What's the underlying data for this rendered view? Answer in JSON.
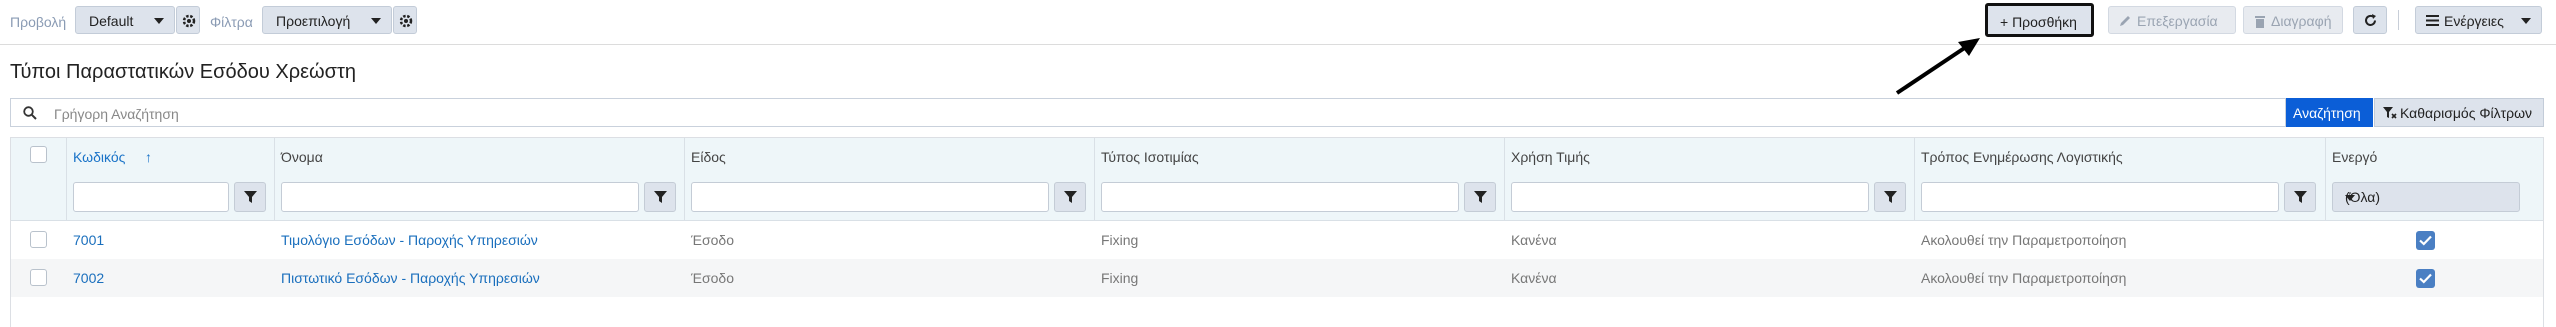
{
  "toolbar": {
    "view_label": "Προβολή",
    "view_value": "Default",
    "filter_label": "Φίλτρα",
    "filter_value": "Προεπιλογή",
    "add_label": "+ Προσθήκη",
    "edit_label": "Επεξεργασία",
    "delete_label": "Διαγραφή",
    "actions_label": "Ενέργειες"
  },
  "page": {
    "title": "Τύποι Παραστατικών Εσόδου Χρεώστη"
  },
  "search": {
    "placeholder": "Γρήγορη Αναζήτηση",
    "search_button": "Αναζήτηση",
    "clear_button": "Καθαρισμός Φίλτρων"
  },
  "grid": {
    "columns": [
      "Κωδικός",
      "Όνομα",
      "Είδος",
      "Τύπος Ισοτιμίας",
      "Χρήση Τιμής",
      "Τρόπος Ενημέρωσης Λογιστικής",
      "Ενεργό"
    ],
    "sort_column": "Κωδικός",
    "sort_direction": "↑",
    "active_filter_value": "(Όλα)",
    "rows": [
      {
        "code": "7001",
        "name": "Τιμολόγιο Εσόδων - Παροχής Υπηρεσιών",
        "kind": "Έσοδο",
        "rate_type": "Fixing",
        "price_use": "Κανένα",
        "accounting_update": "Ακολουθεί την Παραμετροποίηση",
        "active": true
      },
      {
        "code": "7002",
        "name": "Πιστωτικό Εσόδων - Παροχής Υπηρεσιών",
        "kind": "Έσοδο",
        "rate_type": "Fixing",
        "price_use": "Κανένα",
        "accounting_update": "Ακολουθεί την Παραμετροποίηση",
        "active": true
      }
    ]
  },
  "colors": {
    "accent": "#0b5ed7",
    "link": "#1a6fbd",
    "header_bg": "#eef6f9",
    "checkbox_active": "#4a7fc3"
  }
}
